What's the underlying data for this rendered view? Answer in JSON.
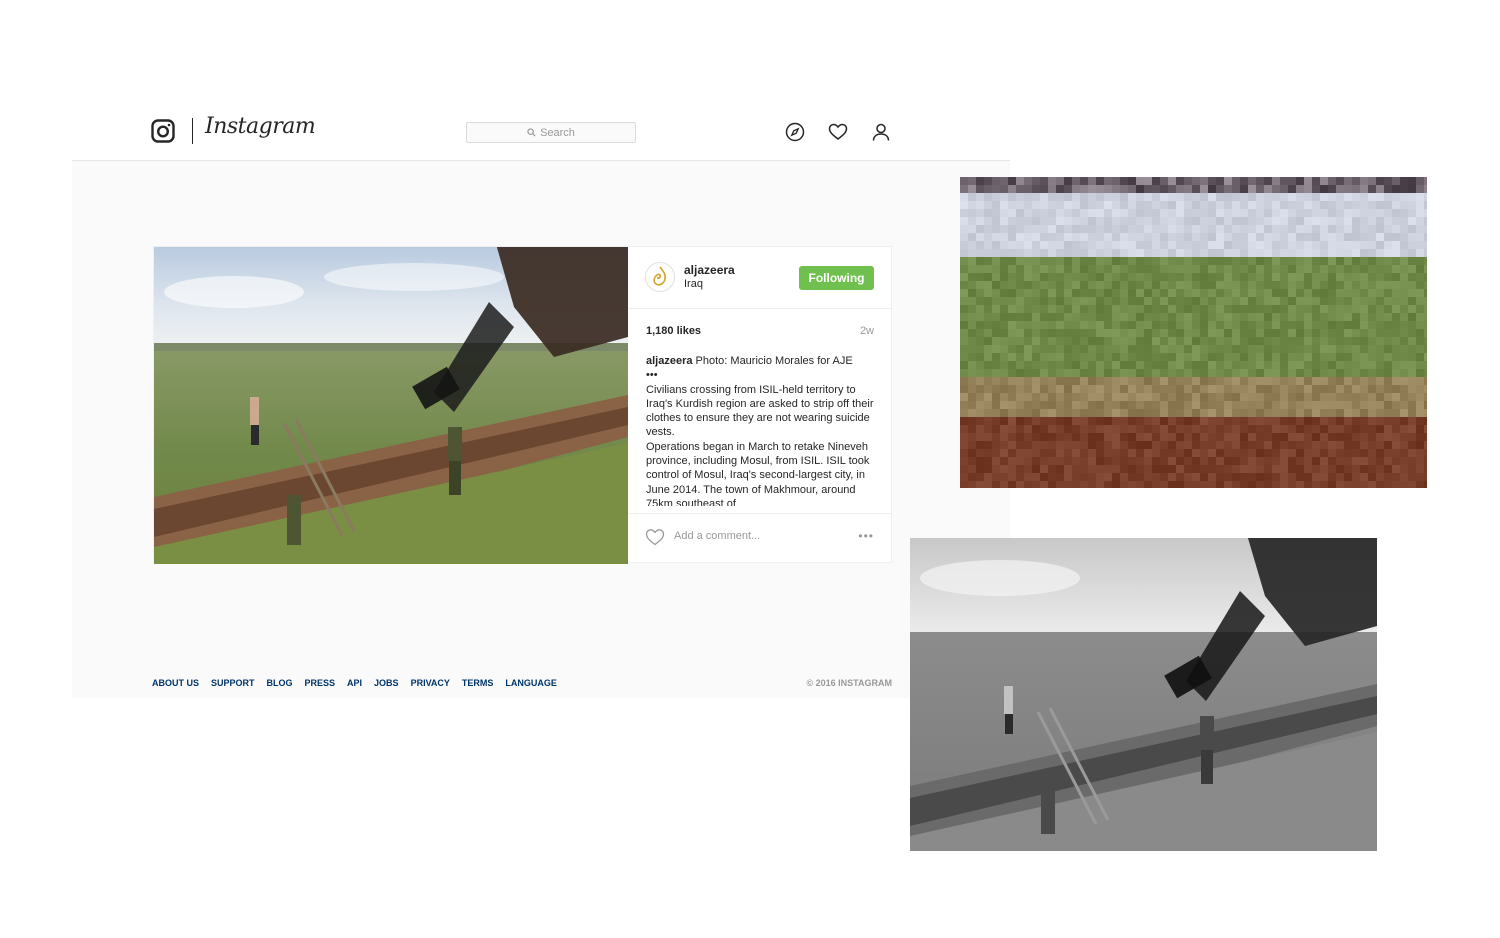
{
  "header": {
    "brand": "Instagram",
    "search_placeholder": "Search",
    "icons": [
      "camera-logo-icon",
      "explore-compass-icon",
      "heart-icon",
      "profile-icon"
    ]
  },
  "post": {
    "username": "aljazeera",
    "location": "Iraq",
    "follow_label": "Following",
    "likes": "1,180 likes",
    "time_ago": "2w",
    "caption_user": "aljazeera",
    "caption_first": "Photo: Mauricio Morales for AJE",
    "caption_dots": "•••",
    "caption_para1": "Civilians crossing from ISIL-held territory to Iraq's Kurdish region are asked to strip off their clothes to ensure they are not wearing suicide vests.",
    "caption_para2": "Operations began in March to retake Nineveh province, including Mosul, from ISIL. ISIL took control of Mosul, Iraq's second-largest city, in June 2014. The town of Makhmour, around 75km southeast of",
    "comment_placeholder": "Add a comment...",
    "more_label": "•••"
  },
  "footer": {
    "links": [
      "ABOUT US",
      "SUPPORT",
      "BLOG",
      "PRESS",
      "API",
      "JOBS",
      "PRIVACY",
      "TERMS",
      "LANGUAGE"
    ],
    "copyright": "© 2016 INSTAGRAM"
  },
  "colors": {
    "follow_button": "#70c050",
    "footer_link": "#003569",
    "muted_text": "#999999",
    "page_background": "#fafafa"
  }
}
